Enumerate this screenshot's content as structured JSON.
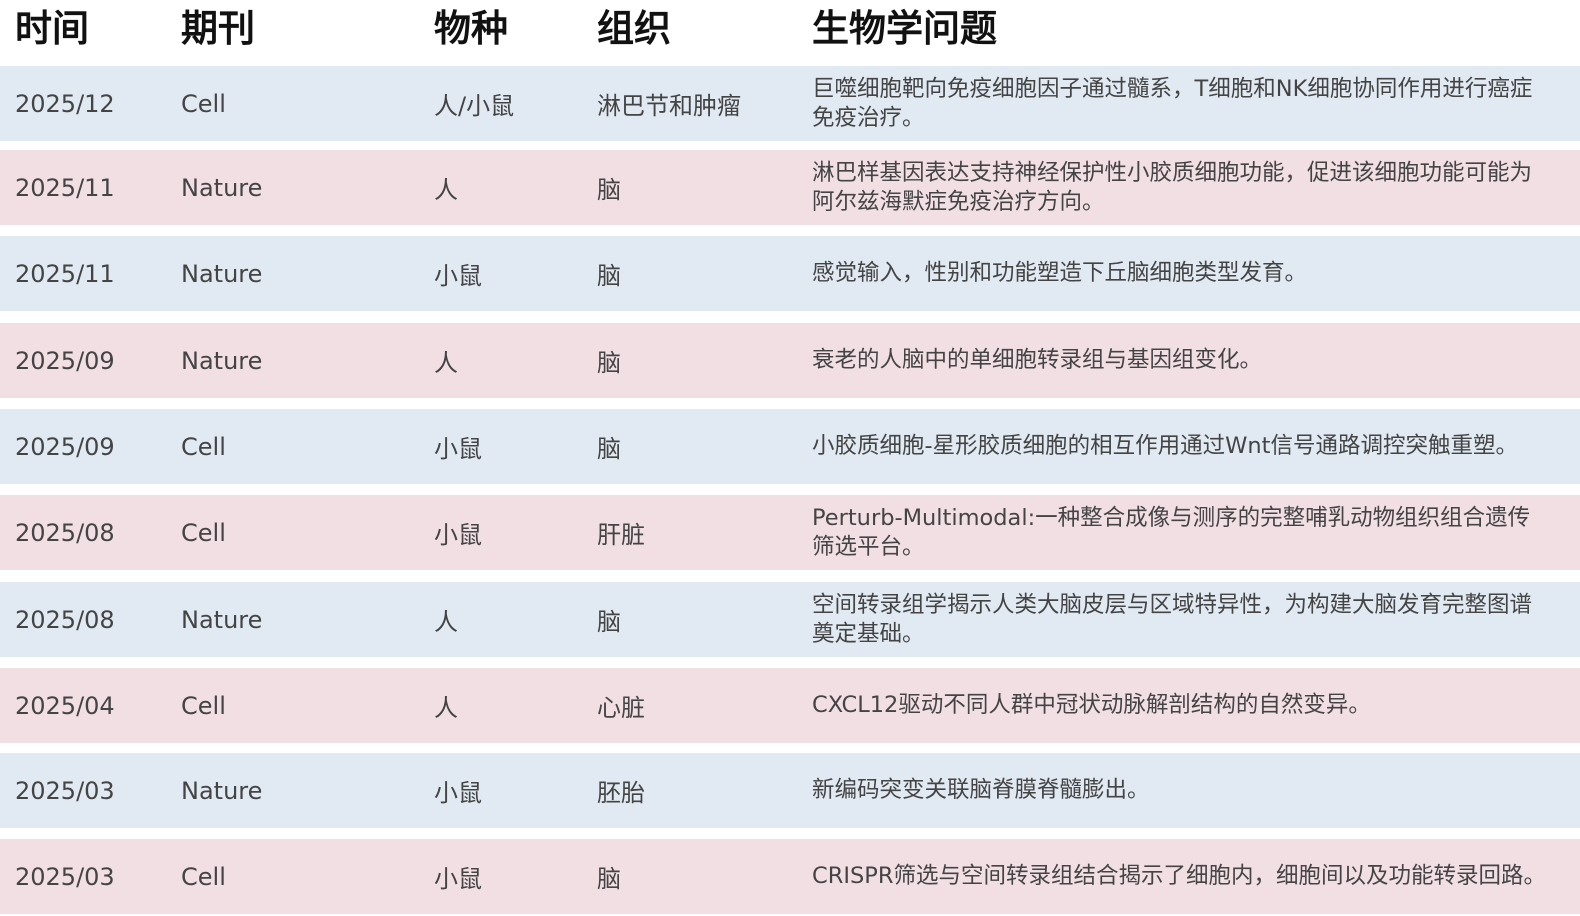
{
  "table": {
    "headers": [
      "时间",
      "期刊",
      "物种",
      "组织",
      "生物学问题"
    ],
    "rows": [
      [
        "2025/12",
        "Cell",
        "人/小鼠",
        "淋巴节和肿瘤",
        "巨噬细胞靶向免疫细胞因子通过髓系，T细胞和NK细胞协同作用进行癌症免疫治疗。"
      ],
      [
        "2025/11",
        "Nature",
        "人",
        "脑",
        "淋巴样基因表达支持神经保护性小胶质细胞功能，促进该细胞功能可能为阿尔兹海默症免疫治疗方向。"
      ],
      [
        "2025/11",
        "Nature",
        "小鼠",
        "脑",
        "感觉输入，性别和功能塑造下丘脑细胞类型发育。"
      ],
      [
        "2025/09",
        "Nature",
        "人",
        "脑",
        "衰老的人脑中的单细胞转录组与基因组变化。"
      ],
      [
        "2025/09",
        "Cell",
        "小鼠",
        "脑",
        "小胶质细胞-星形胶质细胞的相互作用通过Wnt信号通路调控突触重塑。"
      ],
      [
        "2025/08",
        "Cell",
        "小鼠",
        "肝脏",
        "Perturb-Multimodal:一种整合成像与测序的完整哺乳动物组织组合遗传筛选平台。"
      ],
      [
        "2025/08",
        "Nature",
        "人",
        "脑",
        "空间转录组学揭示人类大脑皮层与区域特异性，为构建大脑发育完整图谱奠定基础。"
      ],
      [
        "2025/04",
        "Cell",
        "人",
        "心脏",
        "CXCL12驱动不同人群中冠状动脉解剖结构的自然变异。"
      ],
      [
        "2025/03",
        "Nature",
        "小鼠",
        "胚胎",
        "新编码突变关联脑脊膜脊髓膨出。"
      ],
      [
        "2025/03",
        "Cell",
        "小鼠",
        "脑",
        "CRISPR筛选与空间转录组结合揭示了细胞内，细胞间以及功能转录回路。"
      ]
    ]
  },
  "colors": {
    "row_blue": "#e1eaf2",
    "row_pink": "#f1dfe4",
    "header_text": "#111111",
    "body_text": "#444444"
  }
}
